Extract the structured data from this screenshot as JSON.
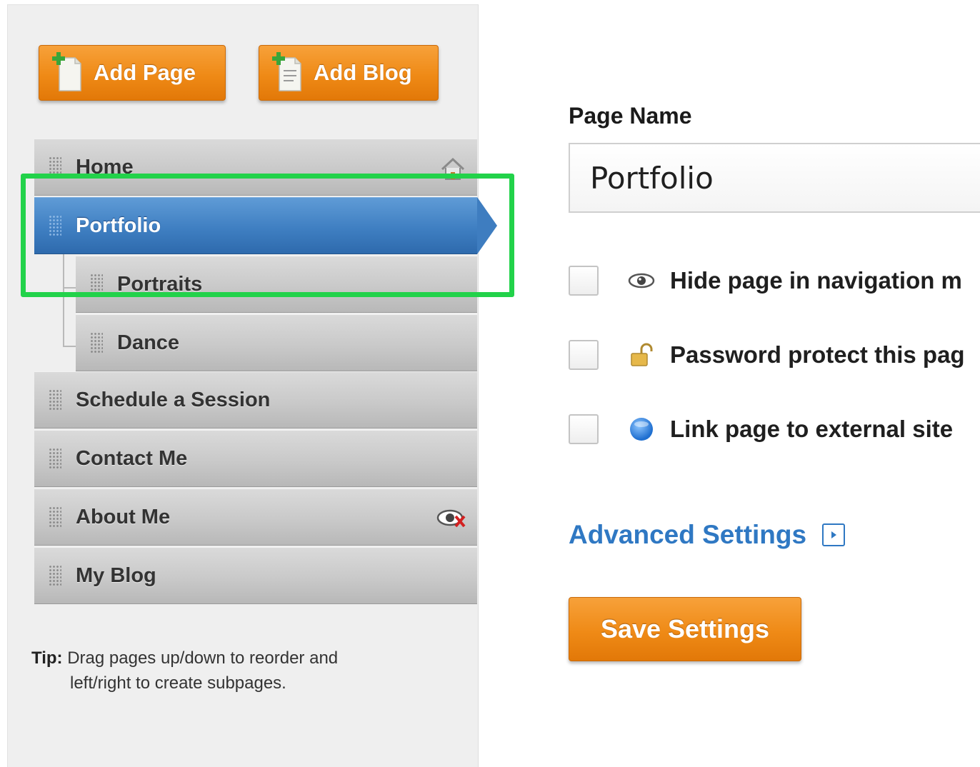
{
  "sidebar": {
    "buttons": {
      "add_page": "Add Page",
      "add_blog": "Add Blog"
    },
    "pages": [
      {
        "label": "Home",
        "icon": "home-icon"
      },
      {
        "label": "Portfolio",
        "state": "selected"
      },
      {
        "label": "Portraits",
        "level": "subpage"
      },
      {
        "label": "Dance",
        "level": "subpage"
      },
      {
        "label": "Schedule a Session"
      },
      {
        "label": "Contact Me"
      },
      {
        "label": "About Me",
        "icon": "hidden-eye-icon"
      },
      {
        "label": "My Blog"
      }
    ],
    "tip": {
      "prefix": "Tip:",
      "line1": "Drag pages up/down to reorder and",
      "line2": "left/right to create subpages."
    }
  },
  "main": {
    "page_name_label": "Page Name",
    "page_name_value": "Portfolio",
    "options": [
      {
        "label": "Hide page in navigation m",
        "icon": "eye-icon",
        "checked": false
      },
      {
        "label": "Password protect this pag",
        "icon": "lock-icon",
        "checked": false
      },
      {
        "label": "Link page to external site",
        "icon": "globe-icon",
        "checked": false
      }
    ],
    "advanced_settings": "Advanced Settings",
    "save_button": "Save Settings"
  },
  "colors": {
    "accent_orange": "#ef8a16",
    "selected_blue": "#3f7fc2",
    "link_blue": "#2f78c3",
    "highlight_green": "#22d24a"
  }
}
